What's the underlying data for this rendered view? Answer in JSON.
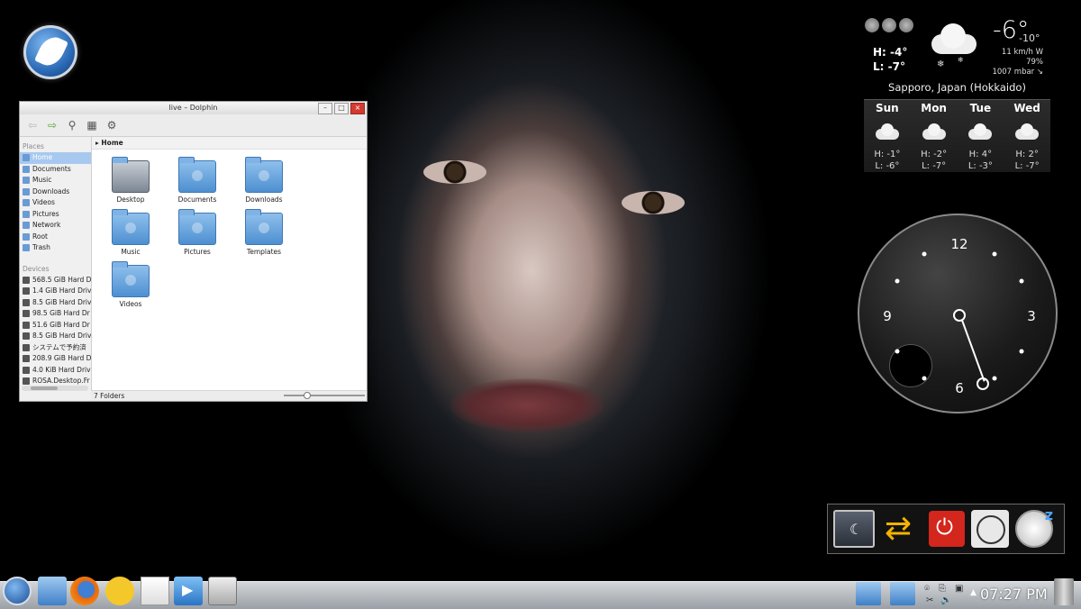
{
  "dolphin": {
    "title": "live – Dolphin",
    "breadcrumb": "Home",
    "places_header": "Places",
    "places": [
      "Home",
      "Documents",
      "Music",
      "Downloads",
      "Videos",
      "Pictures",
      "Network",
      "Root",
      "Trash"
    ],
    "devices_header": "Devices",
    "devices": [
      "568.5 GiB Hard D",
      "1.4 GiB Hard Driv",
      "8.5 GiB Hard Driv",
      "98.5 GiB Hard Dr",
      "51.6 GiB Hard Dr",
      "8.5 GiB Hard Driv",
      "システムで予約済",
      "208.9 GiB Hard D",
      "4.0 KiB Hard Driv",
      "ROSA.Desktop.Fr"
    ],
    "files": [
      "Desktop",
      "Documents",
      "Downloads",
      "Music",
      "Pictures",
      "Templates",
      "Videos"
    ],
    "status": "7 Folders"
  },
  "weather": {
    "high_now": "H: -4°",
    "low_now": "L: -7°",
    "temp_now": "-6°",
    "temp_feel": "-10°",
    "wind": "11 km/h W",
    "humidity": "79%",
    "pressure": "1007 mbar ↘",
    "location": "Sapporo, Japan (Hokkaido)",
    "forecast": [
      {
        "day": "Sun",
        "high": "H: -1°",
        "low": "L: -6°"
      },
      {
        "day": "Mon",
        "high": "H: -2°",
        "low": "L: -7°"
      },
      {
        "day": "Tue",
        "high": "H: 4°",
        "low": "L: -3°"
      },
      {
        "day": "Wed",
        "high": "H: 2°",
        "low": "L: -7°"
      }
    ]
  },
  "clock": {
    "numerals": [
      "12",
      "3",
      "6",
      "9"
    ]
  },
  "taskbar": {
    "time": "07:27 PM"
  }
}
